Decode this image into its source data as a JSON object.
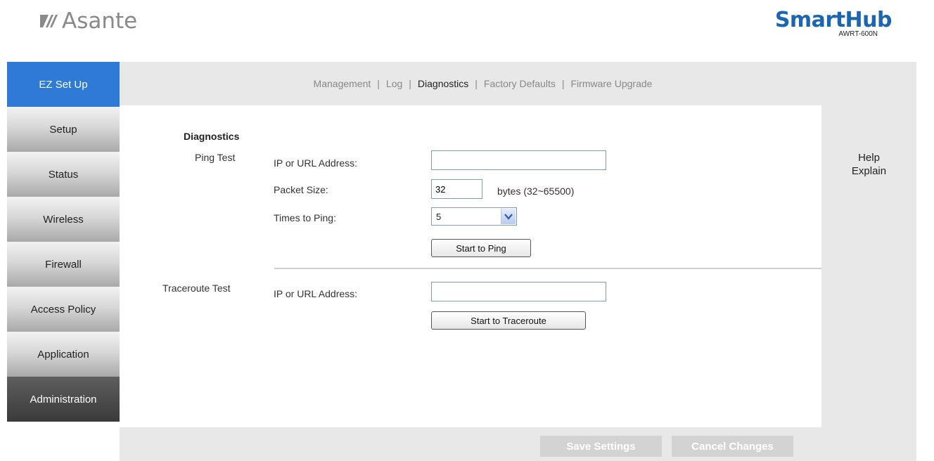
{
  "header": {
    "logo_text": "Asante",
    "brand_name": "SmartHub",
    "brand_model": "AWRT-600N"
  },
  "sidebar": {
    "items": [
      {
        "label": "EZ Set Up"
      },
      {
        "label": "Setup"
      },
      {
        "label": "Status"
      },
      {
        "label": "Wireless"
      },
      {
        "label": "Firewall"
      },
      {
        "label": "Access Policy"
      },
      {
        "label": "Application"
      },
      {
        "label": "Administration"
      }
    ]
  },
  "topnav": {
    "items": [
      {
        "label": "Management"
      },
      {
        "label": "Log"
      },
      {
        "label": "Diagnostics"
      },
      {
        "label": "Factory Defaults"
      },
      {
        "label": "Firmware Upgrade"
      }
    ],
    "separator": "|",
    "current": "Diagnostics"
  },
  "content": {
    "title": "Diagnostics",
    "ping": {
      "section_label": "Ping Test",
      "address_label": "IP or URL Address:",
      "address_value": "",
      "packet_label": "Packet Size:",
      "packet_value": "32",
      "packet_unit": "bytes (32~65500)",
      "times_label": "Times to Ping:",
      "times_value": "5",
      "start_button": "Start to Ping"
    },
    "traceroute": {
      "section_label": "Traceroute Test",
      "address_label": "IP or URL Address:",
      "address_value": "",
      "start_button": "Start to Traceroute"
    }
  },
  "help": {
    "line1": "Help",
    "line2": "Explain"
  },
  "footer": {
    "save_label": "Save Settings",
    "cancel_label": "Cancel Changes"
  },
  "colors": {
    "brand_blue": "#1a66b2",
    "active_nav": "#2f7ad6",
    "panel_gray": "#e8e8e8",
    "disabled_button": "#d3d3d3"
  },
  "icons": {
    "logo": "asante-logo-icon",
    "dropdown": "chevron-down-icon"
  }
}
